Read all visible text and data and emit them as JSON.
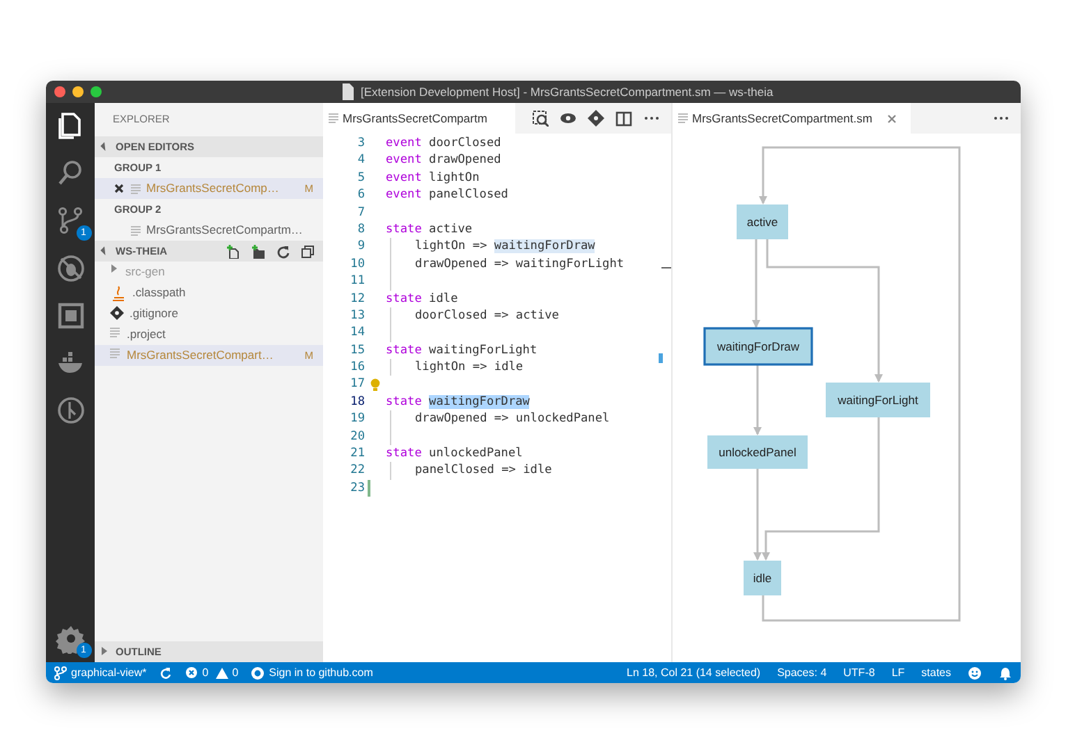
{
  "window": {
    "title": "[Extension Development Host] - MrsGrantsSecretCompartment.sm — ws-theia"
  },
  "activity_bar": {
    "items": [
      {
        "kind": "files",
        "selected": true
      },
      {
        "kind": "search",
        "selected": false
      },
      {
        "kind": "source-control",
        "selected": false,
        "badge": "1"
      },
      {
        "kind": "debug",
        "selected": false
      },
      {
        "kind": "extensions",
        "selected": false
      },
      {
        "kind": "docker",
        "selected": false
      },
      {
        "kind": "history",
        "selected": false
      }
    ],
    "settings": {
      "badge": "1"
    }
  },
  "sidebar": {
    "title": "EXPLORER",
    "open_editors": {
      "label": "OPEN EDITORS",
      "expanded": true,
      "groups": [
        {
          "label": "GROUP 1",
          "files": [
            {
              "name": "MrsGrantsSecretComp…",
              "status": "M",
              "selected": true,
              "closable": true
            }
          ]
        },
        {
          "label": "GROUP 2",
          "files": [
            {
              "name": "MrsGrantsSecretCompartm…",
              "selected": false,
              "closable": false
            }
          ]
        }
      ]
    },
    "workspace": {
      "label": "WS-THEIA",
      "expanded": true,
      "items": [
        {
          "name": "src-gen",
          "kind": "folder",
          "selected": false
        },
        {
          "name": ".classpath",
          "kind": "java",
          "selected": false
        },
        {
          "name": ".gitignore",
          "kind": "git",
          "selected": false
        },
        {
          "name": ".project",
          "kind": "file",
          "selected": false
        },
        {
          "name": "MrsGrantsSecretCompart…",
          "kind": "file",
          "status": "M",
          "selected": true
        }
      ]
    },
    "outline": {
      "label": "OUTLINE",
      "expanded": false
    }
  },
  "editor": {
    "tab": {
      "label": "MrsGrantsSecretCompartm"
    },
    "lines": [
      {
        "number": "3",
        "indent": false,
        "current": false,
        "lightbulb": false,
        "modified": false,
        "tokens": [
          {
            "kind": "keyword",
            "text": "event"
          },
          {
            "kind": "text",
            "text": " doorClosed"
          }
        ]
      },
      {
        "number": "4",
        "indent": false,
        "current": false,
        "lightbulb": false,
        "modified": false,
        "tokens": [
          {
            "kind": "keyword",
            "text": "event"
          },
          {
            "kind": "text",
            "text": " drawOpened"
          }
        ]
      },
      {
        "number": "5",
        "indent": false,
        "current": false,
        "lightbulb": false,
        "modified": false,
        "tokens": [
          {
            "kind": "keyword",
            "text": "event"
          },
          {
            "kind": "text",
            "text": " lightOn"
          }
        ]
      },
      {
        "number": "6",
        "indent": false,
        "current": false,
        "lightbulb": false,
        "modified": false,
        "tokens": [
          {
            "kind": "keyword",
            "text": "event"
          },
          {
            "kind": "text",
            "text": " panelClosed"
          }
        ]
      },
      {
        "number": "7",
        "indent": false,
        "current": false,
        "lightbulb": false,
        "modified": false
      },
      {
        "number": "8",
        "indent": false,
        "current": false,
        "lightbulb": false,
        "modified": false,
        "tokens": [
          {
            "kind": "keyword",
            "text": "state"
          },
          {
            "kind": "text",
            "text": " active"
          }
        ]
      },
      {
        "number": "9",
        "indent": true,
        "current": false,
        "lightbulb": false,
        "modified": false,
        "tokens": [
          {
            "kind": "text",
            "text": "lightOn => "
          },
          {
            "kind": "match",
            "text": "waitingForDraw"
          }
        ]
      },
      {
        "number": "10",
        "indent": true,
        "current": false,
        "lightbulb": false,
        "modified": false,
        "tokens": [
          {
            "kind": "text",
            "text": "drawOpened => waitingForLight"
          }
        ]
      },
      {
        "number": "11",
        "indent": true,
        "current": false,
        "lightbulb": false,
        "modified": false
      },
      {
        "number": "12",
        "indent": false,
        "current": false,
        "lightbulb": false,
        "modified": false,
        "tokens": [
          {
            "kind": "keyword",
            "text": "state"
          },
          {
            "kind": "text",
            "text": " idle"
          }
        ]
      },
      {
        "number": "13",
        "indent": true,
        "current": false,
        "lightbulb": false,
        "modified": false,
        "tokens": [
          {
            "kind": "text",
            "text": "doorClosed => active"
          }
        ]
      },
      {
        "number": "14",
        "indent": true,
        "current": false,
        "lightbulb": false,
        "modified": false
      },
      {
        "number": "15",
        "indent": false,
        "current": false,
        "lightbulb": false,
        "modified": false,
        "tokens": [
          {
            "kind": "keyword",
            "text": "state"
          },
          {
            "kind": "text",
            "text": " waitingForLight"
          }
        ]
      },
      {
        "number": "16",
        "indent": true,
        "current": false,
        "lightbulb": false,
        "modified": false,
        "tokens": [
          {
            "kind": "text",
            "text": "lightOn => idle"
          }
        ]
      },
      {
        "number": "17",
        "indent": false,
        "current": false,
        "lightbulb": true,
        "modified": false
      },
      {
        "number": "18",
        "indent": false,
        "current": true,
        "lightbulb": false,
        "modified": false,
        "tokens": [
          {
            "kind": "keyword",
            "text": "state "
          },
          {
            "kind": "selection",
            "text": "waitingForDraw"
          }
        ]
      },
      {
        "number": "19",
        "indent": true,
        "current": false,
        "lightbulb": false,
        "modified": false,
        "tokens": [
          {
            "kind": "text",
            "text": "drawOpened => unlockedPanel"
          }
        ]
      },
      {
        "number": "20",
        "indent": true,
        "current": false,
        "lightbulb": false,
        "modified": false
      },
      {
        "number": "21",
        "indent": false,
        "current": false,
        "lightbulb": false,
        "modified": false,
        "tokens": [
          {
            "kind": "keyword",
            "text": "state"
          },
          {
            "kind": "text",
            "text": " unlockedPanel"
          }
        ]
      },
      {
        "number": "22",
        "indent": true,
        "current": false,
        "lightbulb": false,
        "modified": false,
        "tokens": [
          {
            "kind": "text",
            "text": "panelClosed => idle"
          }
        ]
      },
      {
        "number": "23",
        "indent": false,
        "current": false,
        "lightbulb": false,
        "modified": true
      }
    ]
  },
  "diagram": {
    "tab": {
      "label": "MrsGrantsSecretCompartment.sm"
    },
    "nodes": [
      {
        "label": "active",
        "selected": false
      },
      {
        "label": "waitingForDraw",
        "selected": true
      },
      {
        "label": "waitingForLight",
        "selected": false
      },
      {
        "label": "unlockedPanel",
        "selected": false
      },
      {
        "label": "idle",
        "selected": false
      }
    ]
  },
  "status_bar": {
    "branch": "graphical-view*",
    "errors": "0",
    "warnings": "0",
    "sign_in": "Sign in to github.com",
    "right": [
      "Ln 18, Col 21 (14 selected)",
      "Spaces: 4",
      "UTF-8",
      "LF",
      "states"
    ]
  }
}
